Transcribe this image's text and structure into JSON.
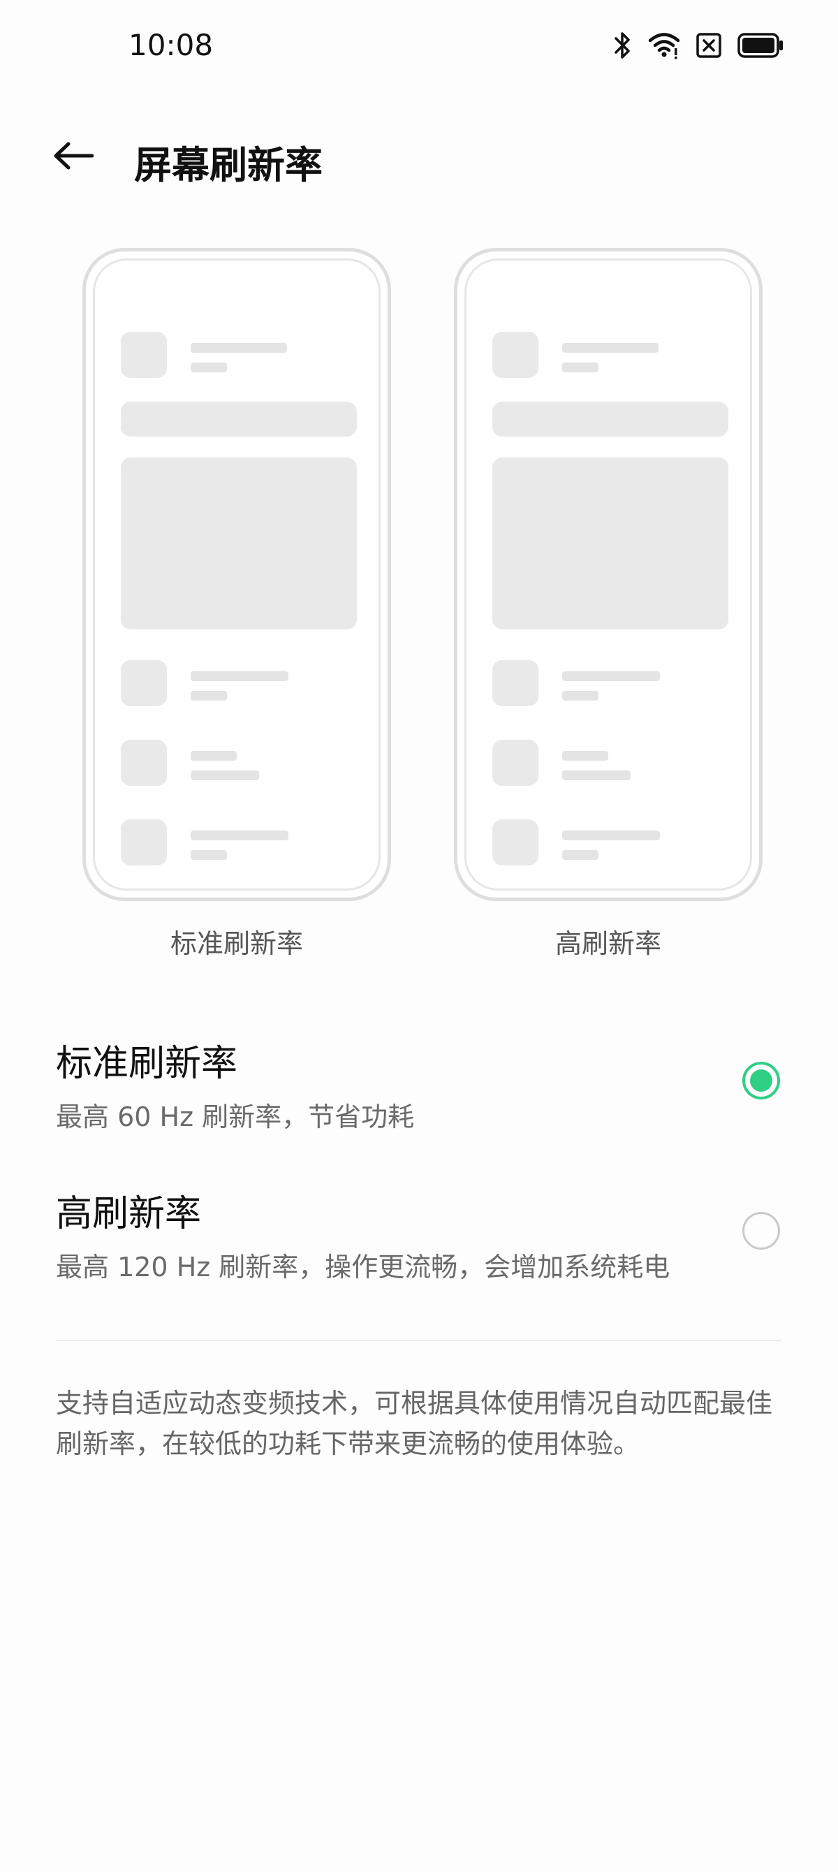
{
  "status_bar": {
    "time": "10:08",
    "icons": [
      "bluetooth-icon",
      "wifi-icon",
      "sim-off-icon",
      "battery-icon"
    ]
  },
  "header": {
    "back_icon": "arrow-left-icon",
    "title": "屏幕刷新率"
  },
  "previews": [
    {
      "label": "标准刷新率"
    },
    {
      "label": "高刷新率"
    }
  ],
  "options": [
    {
      "title": "标准刷新率",
      "description": "最高 60 Hz 刷新率，节省功耗",
      "selected": true
    },
    {
      "title": "高刷新率",
      "description": "最高 120 Hz 刷新率，操作更流畅，会增加系统耗电",
      "selected": false
    }
  ],
  "footnote": "支持自适应动态变频技术，可根据具体使用情况自动匹配最佳刷新率，在较低的功耗下带来更流畅的使用体验。",
  "colors": {
    "accent": "#2fcf84",
    "background": "#fdfdfd"
  }
}
